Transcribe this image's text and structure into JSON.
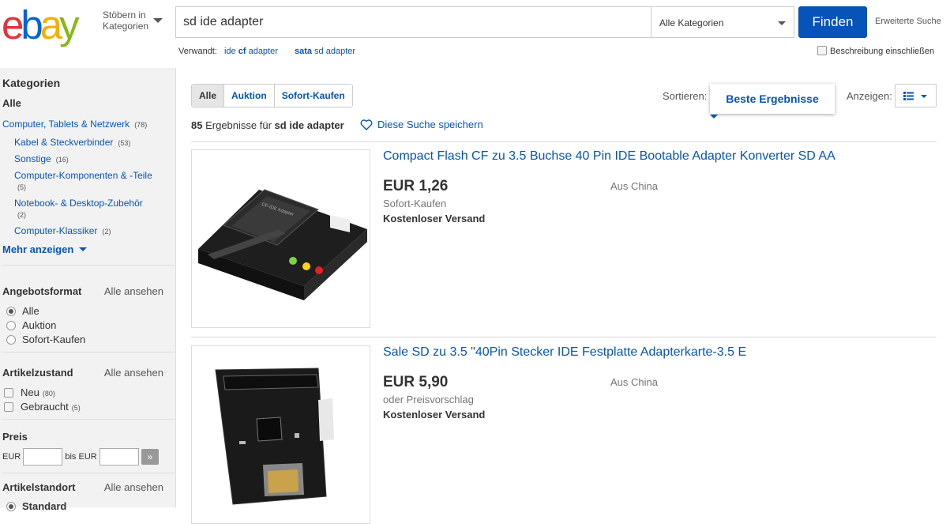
{
  "header": {
    "logo": {
      "e": "e",
      "b": "b",
      "a": "a",
      "y": "y",
      "colors": [
        "#e53238",
        "#0064d2",
        "#f5af02",
        "#86b817"
      ]
    },
    "browse_label": "Stöbern in Kategorien",
    "search_value": "sd ide adapter",
    "category_select": "Alle Kategorien",
    "find_label": "Finden",
    "advanced_label": "Erweiterte Suche",
    "related_label": "Verwandt:",
    "related": [
      {
        "bold": "",
        "pre": "ide",
        "b": "cf",
        "post": "adapter"
      },
      {
        "pre": "",
        "b": "sata",
        "post": "sd adapter"
      }
    ],
    "desc_checkbox_label": "Beschreibung einschließen",
    "accent": "#0654ba"
  },
  "sidebar": {
    "categories_title": "Kategorien",
    "all_label": "Alle",
    "top_category": {
      "label": "Computer, Tablets & Netzwerk",
      "count": "(78)"
    },
    "subcategories": [
      {
        "label": "Kabel & Steckverbinder",
        "count": "(53)"
      },
      {
        "label": "Sonstige",
        "count": "(16)"
      },
      {
        "label": "Computer-Komponenten & -Teile",
        "count": "(5)"
      },
      {
        "label": "Notebook- & Desktop-Zubehör",
        "count": "(2)"
      },
      {
        "label": "Computer-Klassiker",
        "count": "(2)"
      }
    ],
    "more_label": "Mehr anzeigen",
    "format": {
      "title": "Angebotsformat",
      "see_all": "Alle ansehen",
      "options": [
        "Alle",
        "Auktion",
        "Sofort-Kaufen"
      ],
      "selected": 0
    },
    "condition": {
      "title": "Artikelzustand",
      "see_all": "Alle ansehen",
      "options": [
        {
          "label": "Neu",
          "count": "(80)"
        },
        {
          "label": "Gebraucht",
          "count": "(5)"
        }
      ]
    },
    "price": {
      "title": "Preis",
      "from_label": "EUR",
      "to_label": "bis EUR",
      "go": "»"
    },
    "location": {
      "title": "Artikelstandort",
      "see_all": "Alle ansehen",
      "first_option": "Standard"
    }
  },
  "main": {
    "tabs": [
      "Alle",
      "Auktion",
      "Sofort-Kaufen"
    ],
    "active_tab": 0,
    "sort_label": "Sortieren:",
    "sort_value": "Beste Ergebnisse",
    "view_label": "Anzeigen:",
    "result_count": "85",
    "result_text": "Ergebnisse für",
    "query": "sd ide adapter",
    "save_search": "Diese Suche speichern",
    "items": [
      {
        "title": "Compact Flash CF zu 3.5 Buchse 40 Pin IDE Bootable Adapter Konverter SD AA",
        "price": "EUR 1,26",
        "format": "Sofort-Kaufen",
        "shipping": "Kostenloser Versand",
        "location": "Aus China"
      },
      {
        "title": "Sale SD zu 3.5 \"40Pin Stecker IDE Festplatte Adapterkarte-3.5 E",
        "price": "EUR 5,90",
        "format": "oder Preisvorschlag",
        "shipping": "Kostenloser Versand",
        "location": "Aus China"
      }
    ]
  }
}
